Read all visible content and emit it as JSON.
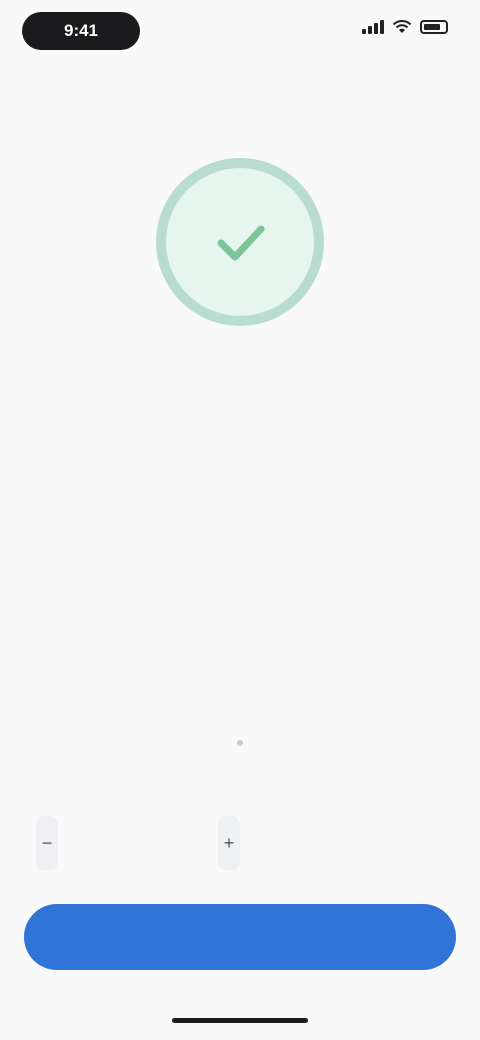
{
  "status_bar": {
    "time": "9:41"
  },
  "icons": {
    "checkmark": "checkmark-icon",
    "signal": "cellular-signal-icon",
    "wifi": "wifi-icon",
    "battery": "battery-icon"
  },
  "colors": {
    "success": "#4caf50",
    "ring": "#b8dcd2",
    "primary": "#2f74d6",
    "tag": "#e5a15a"
  },
  "success": {
    "title": "",
    "subtitle": ""
  },
  "card": {
    "label": "",
    "tag": "",
    "body": ""
  },
  "quantity": {
    "minus": "−",
    "plus": "+",
    "value": "",
    "caption": ""
  },
  "total": {
    "value": "",
    "caption": ""
  },
  "primary_button": {
    "label": ""
  }
}
